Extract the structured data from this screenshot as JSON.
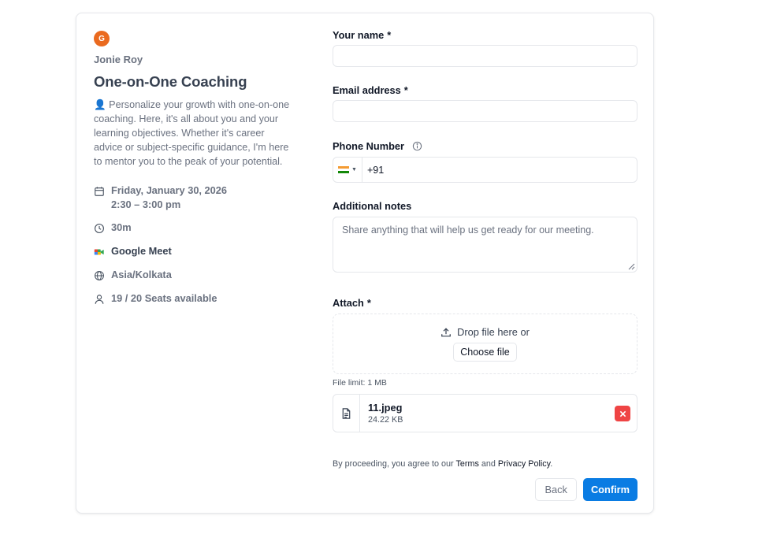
{
  "event": {
    "avatar_initial": "G",
    "host": "Jonie Roy",
    "title": "One-on-One Coaching",
    "description": "👤 Personalize your growth with one-on-one coaching. Here, it's all about you and your learning objectives. Whether it's career advice or subject-specific guidance, I'm here to mentor you to the peak of your potential.",
    "date": "Friday, January 30, 2026",
    "time": "2:30 – 3:00 pm",
    "duration": "30m",
    "location": "Google Meet",
    "timezone": "Asia/Kolkata",
    "seats": "19 / 20 Seats available"
  },
  "form": {
    "name_label": "Your name",
    "name_value": "",
    "email_label": "Email address",
    "email_value": "",
    "required_mark": "*",
    "phone_label": "Phone Number",
    "phone_value": "+91",
    "notes_label": "Additional notes",
    "notes_placeholder": "Share anything that will help us get ready for our meeting.",
    "attach_label": "Attach",
    "drop_text": "Drop file here or",
    "choose_label": "Choose file",
    "file_limit": "File limit: 1 MB",
    "file_name": "11.jpeg",
    "file_size": "24.22 KB"
  },
  "legal": {
    "prefix": "By proceeding, you agree to our",
    "terms": "Terms",
    "and": "and",
    "privacy": "Privacy Policy",
    "suffix": "."
  },
  "actions": {
    "back_label": "Back",
    "confirm_label": "Confirm"
  },
  "colors": {
    "accent": "#0a7ce3",
    "avatar": "#ea6a1f",
    "remove": "#ef4444"
  },
  "icons": [
    "calendar-icon",
    "clock-icon",
    "google-meet-icon",
    "globe-icon",
    "user-icon",
    "info-icon",
    "upload-icon",
    "file-icon",
    "close-icon"
  ]
}
